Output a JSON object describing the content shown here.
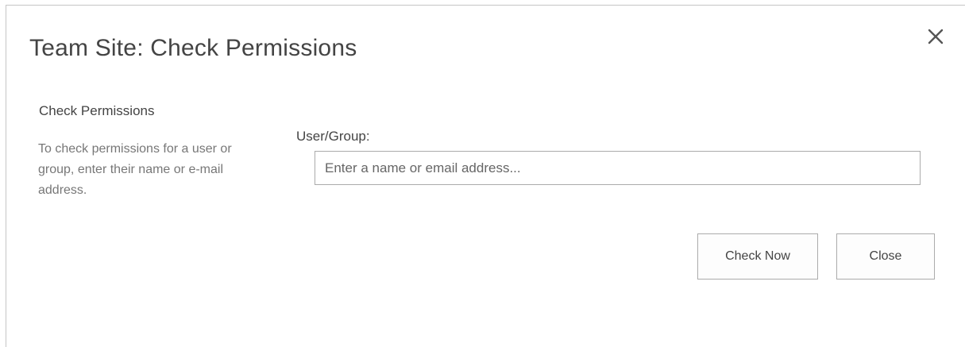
{
  "dialog": {
    "title": "Team Site: Check Permissions",
    "close_icon": "close-icon"
  },
  "section": {
    "title": "Check Permissions",
    "description": "To check permissions for a user or group, enter their name or e-mail address."
  },
  "user_group": {
    "label": "User/Group:",
    "value": "",
    "placeholder": "Enter a name or email address..."
  },
  "buttons": {
    "check_now": "Check Now",
    "close": "Close"
  }
}
